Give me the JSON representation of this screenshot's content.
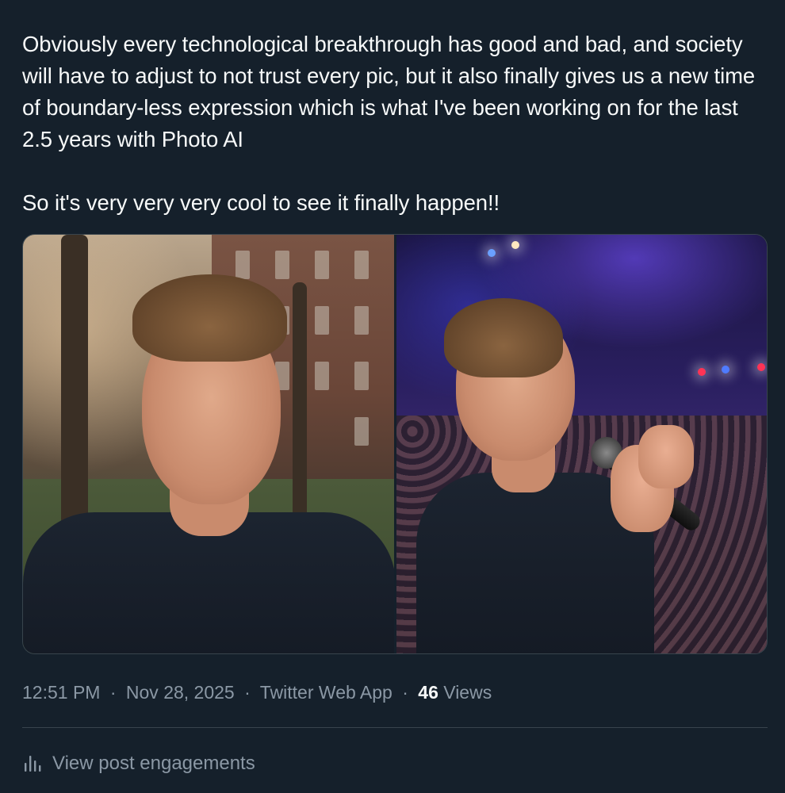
{
  "tweet": {
    "paragraph_1": "Obviously every technological breakthrough has good and bad, and society will have to adjust to not trust every pic, but it also finally gives us a new time of boundary-less expression which is what I've been working on for the last 2.5 years with Photo AI",
    "paragraph_2": "So it's very very very cool to see it finally happen!!"
  },
  "media": {
    "left_photo_alt": "Portrait of a man in a dark t-shirt standing outdoors on a city street",
    "right_photo_alt": "Man holding a microphone on stage in front of a concert crowd"
  },
  "meta": {
    "time": "12:51 PM",
    "date": "Nov 28, 2025",
    "source": "Twitter Web App",
    "views_count": "46",
    "views_label": "Views",
    "separator": "·"
  },
  "engagements": {
    "label": "View post engagements",
    "icon": "bar-chart-icon"
  },
  "colors": {
    "background": "#15202b",
    "text": "#f7f9f9",
    "muted": "#8b98a5",
    "border": "#38444d"
  }
}
